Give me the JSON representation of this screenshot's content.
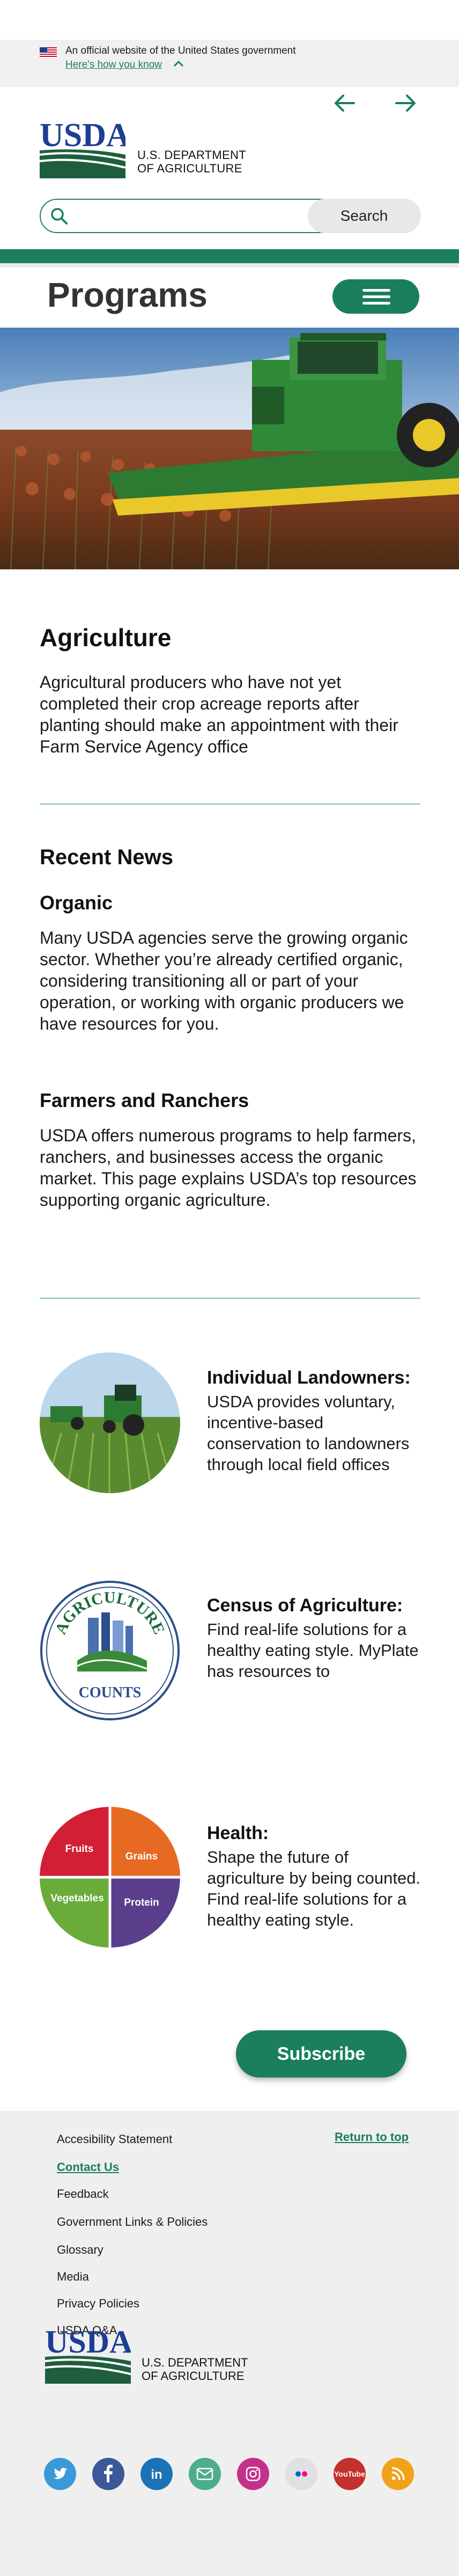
{
  "gov_banner": {
    "text": "An official website of the United States government",
    "link": "Here's how you know"
  },
  "logo": {
    "text": "USDA",
    "dept_line1": "U.S. DEPARTMENT",
    "dept_line2": "OF AGRICULTURE"
  },
  "search": {
    "placeholder": "",
    "button": "Search"
  },
  "page": {
    "title": "Programs"
  },
  "intro": {
    "title": "Agriculture",
    "text": "Agricultural producers who have not yet completed their crop acreage reports after planting should make an appointment with their Farm Service Agency office"
  },
  "news": {
    "title": "Recent News",
    "items": [
      {
        "title": "Organic",
        "text": "Many USDA agencies serve the growing organic sector. Whether you’re already certified organic, considering transitioning all or part of your operation, or working with organic producers we have resources for you."
      },
      {
        "title": "Farmers and Ranchers",
        "text": "USDA offers numerous programs to help farmers, ranchers, and businesses access the organic market. This page explains USDA’s top resources supporting organic agriculture."
      }
    ]
  },
  "features": [
    {
      "title": "Individual Landowners:",
      "text": "USDA provides voluntary, incentive-based conservation to landowners through local field offices"
    },
    {
      "title": "Census of Agriculture:",
      "text": "Find real-life solutions for a healthy eating style. MyPlate has resources to"
    },
    {
      "title": "Health:",
      "text": "Shape the future of agriculture by being counted. Find real-life solutions for a healthy eating style."
    }
  ],
  "census_logo": {
    "top": "AGRICULTURE",
    "bottom": "COUNTS"
  },
  "myplate": {
    "fruits": "Fruits",
    "grains": "Grains",
    "vegetables": "Vegetables",
    "protein": "Protein"
  },
  "subscribe": "Subscribe",
  "footer": {
    "return_top": "Return to top",
    "links": [
      "Accesibility Statement",
      "Contact Us",
      "Feedback",
      "Government Links & Policies",
      "Glossary",
      "Media",
      "Privacy Policies",
      "USDA Q&A"
    ],
    "social": [
      {
        "name": "twitter",
        "color": "#3a9ad9"
      },
      {
        "name": "facebook",
        "color": "#3b5998"
      },
      {
        "name": "linkedin",
        "color": "#1b73b5"
      },
      {
        "name": "email",
        "color": "#4cae8b"
      },
      {
        "name": "instagram",
        "color": "#c4318a"
      },
      {
        "name": "flickr",
        "color": "#e0e0e0"
      },
      {
        "name": "youtube",
        "color": "#c4302b"
      },
      {
        "name": "rss",
        "color": "#f0a21a"
      }
    ]
  }
}
